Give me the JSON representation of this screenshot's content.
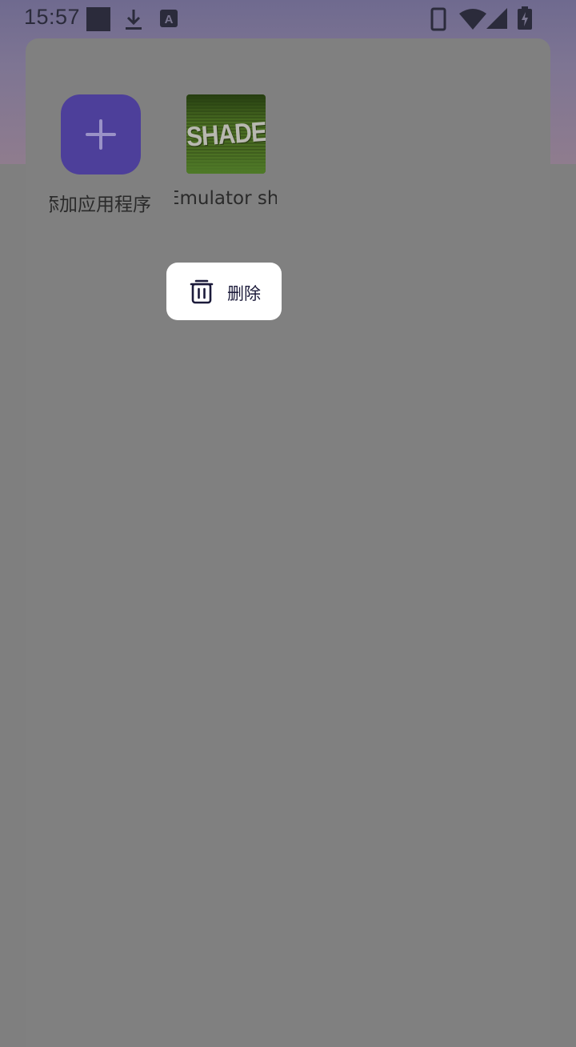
{
  "status_bar": {
    "time": "15:57",
    "left_icons": [
      "square-notification-icon",
      "download-icon",
      "font-badge-icon"
    ],
    "right_icons": [
      "phone-icon",
      "wifi-icon",
      "signal-icon",
      "battery-charging-icon"
    ]
  },
  "apps": [
    {
      "label": "添加应用程序",
      "icon": "plus-icon",
      "color": "#4d3f9a"
    },
    {
      "label": "Emulator sh",
      "icon": "shader-app-icon",
      "icon_text": "SHADER",
      "color": "#4a6d22"
    }
  ],
  "context_menu": {
    "items": [
      {
        "label": "删除",
        "icon": "trash-icon"
      }
    ]
  },
  "colors": {
    "scrim": "#808080",
    "accent": "#4d3f9a",
    "menu_text": "#1b1a3a"
  }
}
